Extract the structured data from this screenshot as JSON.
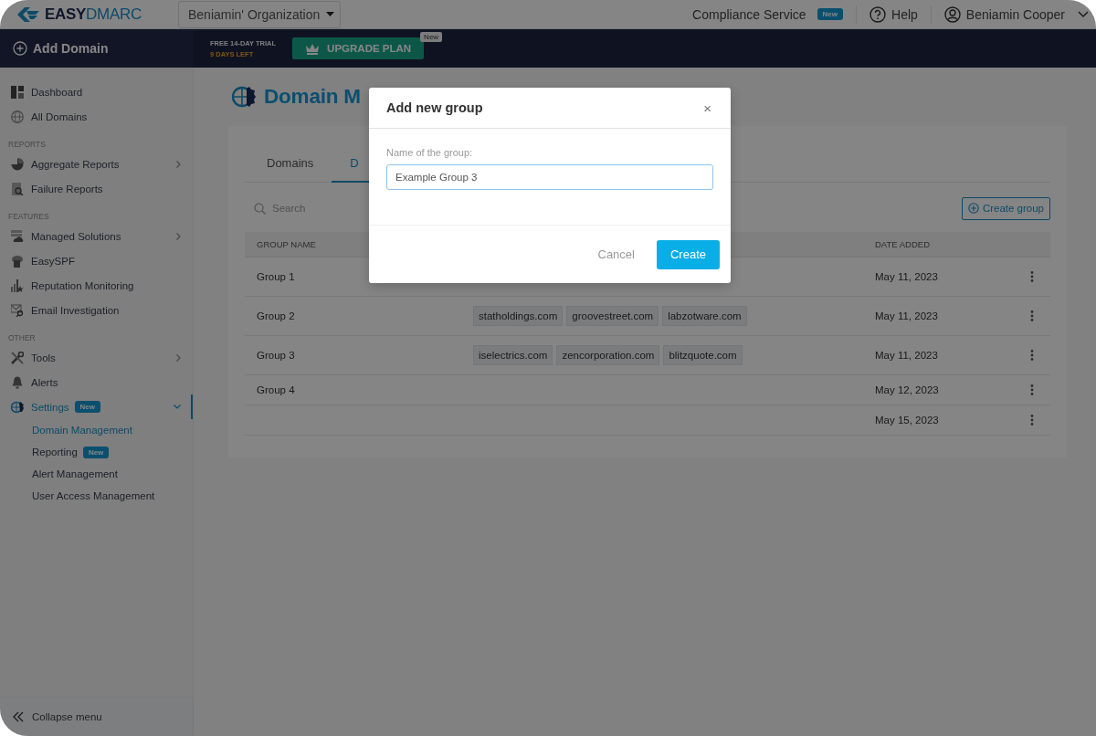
{
  "topbar": {
    "logo": {
      "part1": "EASY",
      "part2": "DMARC"
    },
    "organization": "Beniamin' Organization",
    "compliance": {
      "label": "Compliance Service",
      "badge": "New"
    },
    "help": "Help",
    "user": "Beniamin Cooper"
  },
  "actionbar": {
    "add_domain": "Add Domain",
    "trial": "FREE 14-DAY TRIAL",
    "days_left": "9 DAYS LEFT",
    "upgrade": {
      "label": "UPGRADE PLAN",
      "badge": "New"
    }
  },
  "sidebar": {
    "items": [
      {
        "kind": "item",
        "label": "Dashboard",
        "selected": false
      },
      {
        "kind": "item",
        "label": "All Domains",
        "selected": false
      },
      {
        "kind": "section",
        "label": "REPORTS"
      },
      {
        "kind": "item",
        "label": "Aggregate Reports",
        "selected": false,
        "expandable": true,
        "expanded": false
      },
      {
        "kind": "item",
        "label": "Failure Reports",
        "selected": false
      },
      {
        "kind": "section",
        "label": "FEATURES"
      },
      {
        "kind": "item",
        "label": "Managed Solutions",
        "selected": false,
        "expandable": true,
        "expanded": false
      },
      {
        "kind": "item",
        "label": "EasySPF",
        "selected": false
      },
      {
        "kind": "item",
        "label": "Reputation Monitoring",
        "selected": false
      },
      {
        "kind": "item",
        "label": "Email Investigation",
        "selected": false
      },
      {
        "kind": "section",
        "label": "OTHER"
      },
      {
        "kind": "item",
        "label": "Tools",
        "selected": false,
        "expandable": true,
        "expanded": false
      },
      {
        "kind": "item",
        "label": "Alerts",
        "selected": false
      },
      {
        "kind": "item",
        "label": "Settings",
        "selected": true,
        "badge": "New",
        "expandable": true,
        "expanded": true,
        "children": [
          {
            "label": "Domain Management",
            "selected": true
          },
          {
            "label": "Reporting",
            "selected": false,
            "badge": "New"
          },
          {
            "label": "Alert Management",
            "selected": false
          },
          {
            "label": "User Access Management",
            "selected": false
          }
        ]
      }
    ],
    "collapse": "Collapse menu"
  },
  "page": {
    "title": "Domain M",
    "tabs": [
      {
        "label": "Domains",
        "selected": false
      },
      {
        "label": "D",
        "selected": true
      }
    ],
    "search": {
      "placeholder": "Search"
    },
    "create_group": "Create group",
    "table": {
      "columns": [
        "GROUP NAME",
        "DATE ADDED"
      ],
      "rows": [
        {
          "group": "Group 1",
          "domains": [],
          "date": "May 11, 2023"
        },
        {
          "group": "Group 2",
          "domains": [
            "statholdings.com",
            "groovestreet.com",
            "labzotware.com"
          ],
          "date": "May 11, 2023"
        },
        {
          "group": "Group 3",
          "domains": [
            "iselectrics.com",
            "zencorporation.com",
            "blitzquote.com"
          ],
          "date": "May 11, 2023"
        },
        {
          "group": "Group 4",
          "domains": [],
          "date": "May 12, 2023"
        },
        {
          "group": "",
          "domains": [],
          "date": "May 15, 2023"
        }
      ]
    }
  },
  "modal": {
    "title": "Add new group",
    "close": "×",
    "field_label": "Name of the group:",
    "value": "Example Group 3",
    "buttons": [
      {
        "label": "Cancel",
        "kind": "secondary"
      },
      {
        "label": "Create",
        "kind": "primary"
      }
    ]
  }
}
